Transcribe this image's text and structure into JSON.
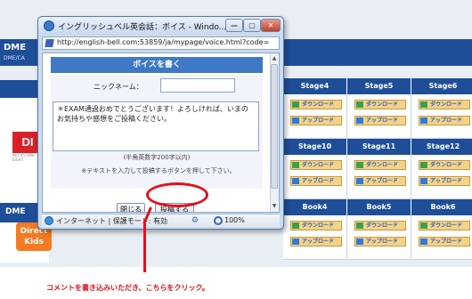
{
  "background": {
    "site_logo": "DME",
    "site_sub": "DME/CA",
    "left_logo": "DI",
    "left_logo_small": "NET-45 DME EIGHT",
    "band_label": "DME",
    "kids_logo": "Direct Kids",
    "columns": [
      {
        "headers": [
          "Stage4",
          "Stage10",
          "Book4"
        ]
      },
      {
        "headers": [
          "Stage5",
          "Stage11",
          "Book5"
        ]
      },
      {
        "headers": [
          "Stage6",
          "Stage12",
          "Book6"
        ]
      }
    ],
    "download_label": "ダウンロード",
    "upload_label": "アップロード"
  },
  "window": {
    "title": "イングリッシュベル英会話：ボイス - Windo...",
    "minimize_glyph": "—",
    "maximize_glyph": "▢",
    "close_glyph": "✕",
    "address": "http://english-bell.com:53859/ja/mypage/voice.html?code=",
    "section_title": "ボイスを書く",
    "nickname_label": "ニックネーム：",
    "nickname_value": "",
    "comment_text": "＊EXAM通過おめでとうございます！よろしければ、いまのお気持ちや感想をご投稿ください。",
    "char_limit": "(半角英数字200字以内)",
    "instruction": "※テキストを入力して投稿するボタンを押して下さい。",
    "close_button": "閉じる",
    "submit_button": "投稿する",
    "status_text": "インターネット | 保護モード: 有効",
    "zoom": "100%"
  },
  "annotation": {
    "caption": "コメントを書き込みいただき、こちらをクリック。",
    "color": "#e3101a"
  }
}
